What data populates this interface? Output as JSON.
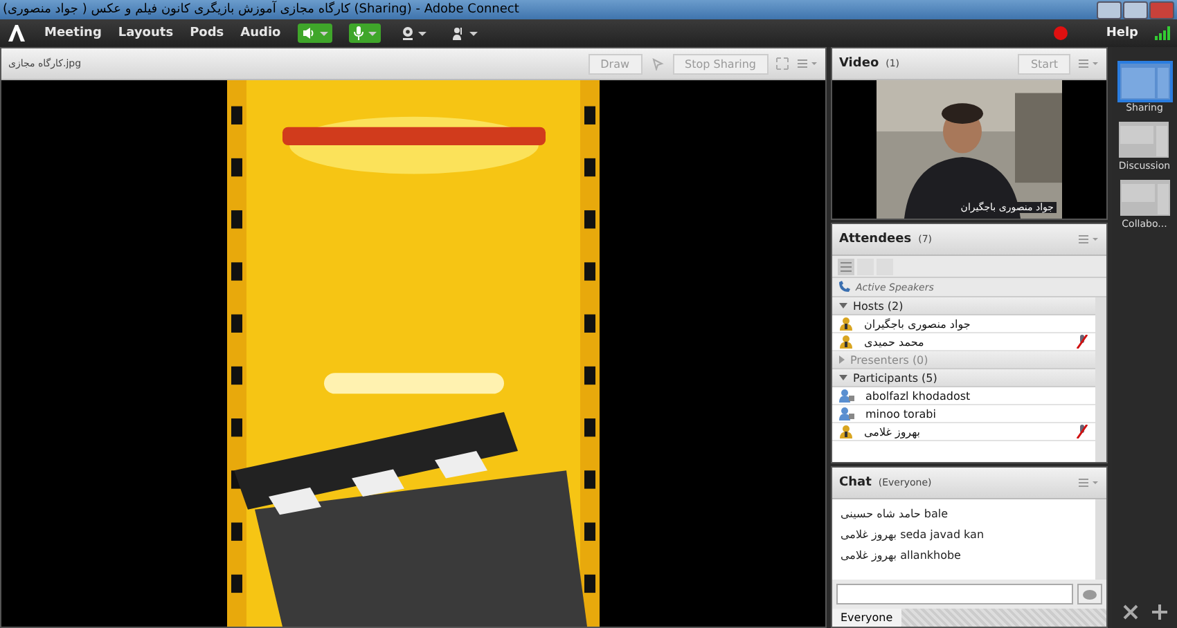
{
  "window": {
    "title": "(کارگاه مجازی آموزش بازیگری کانون فیلم و عکس ( جواد منصوری (Sharing) - Adobe Connect"
  },
  "menu": [
    "Meeting",
    "Layouts",
    "Pods",
    "Audio"
  ],
  "toolbar": [
    {
      "kind": "speaker",
      "on": true
    },
    {
      "kind": "mic",
      "on": true
    },
    {
      "kind": "camera",
      "on": false
    },
    {
      "kind": "hand",
      "on": false
    }
  ],
  "recording": true,
  "help": "Help",
  "share": {
    "file": "کارگاه مجازی.jpg",
    "buttons": [
      "Draw",
      "Stop Sharing"
    ]
  },
  "video": {
    "title": "Video",
    "count": "(1)",
    "start": "Start",
    "caption": "جواد منصوری باجگیران"
  },
  "attendees": {
    "title": "Attendees",
    "count": "(7)",
    "active_speakers": "Active Speakers",
    "groups": [
      {
        "label": "Hosts (2)",
        "expanded": true,
        "people": [
          {
            "name": "جواد منصوری باجگیران",
            "kind": "host",
            "mic_muted": false
          },
          {
            "name": "محمد حمیدی",
            "kind": "host",
            "mic_muted": true
          }
        ]
      },
      {
        "label": "Presenters (0)",
        "expanded": false
      },
      {
        "label": "Participants (5)",
        "expanded": true,
        "people": [
          {
            "name": "abolfazl khodadost",
            "kind": "participant",
            "mic_muted": false
          },
          {
            "name": "minoo torabi",
            "kind": "participant",
            "mic_muted": false
          },
          {
            "name": "بهروز غلامی",
            "kind": "host",
            "mic_muted": true
          }
        ]
      }
    ]
  },
  "chat": {
    "title": "Chat",
    "scope": "(Everyone)",
    "messages": [
      {
        "sender": "حامد شاه حسینی",
        "text": "bale"
      },
      {
        "sender": "بهروز غلامی",
        "text": "seda javad kan"
      },
      {
        "sender": "بهروز غلامی",
        "text": "allankhobe"
      }
    ],
    "tabs": [
      {
        "label": "Everyone",
        "selected": true
      }
    ]
  },
  "layouts": [
    {
      "label": "Sharing",
      "selected": true
    },
    {
      "label": "Discussion",
      "selected": false
    },
    {
      "label": "Collabo...",
      "selected": false
    }
  ]
}
